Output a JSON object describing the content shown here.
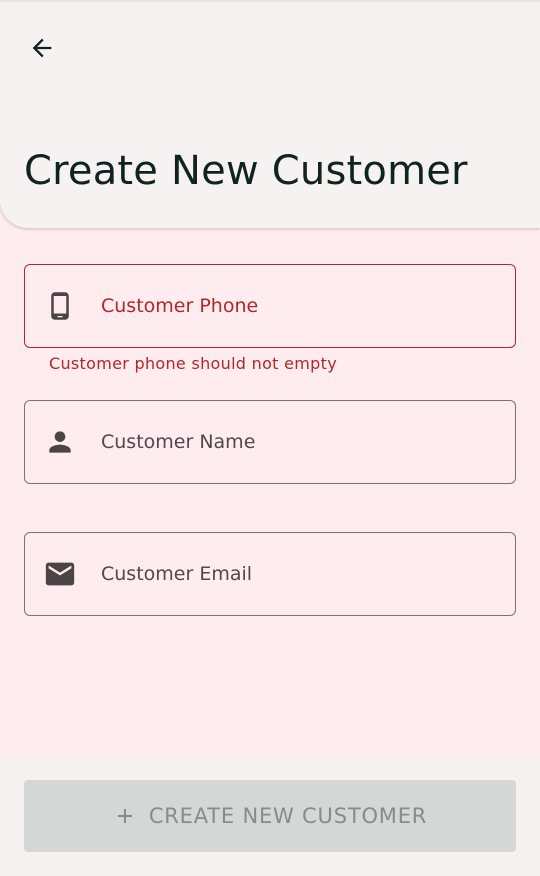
{
  "header": {
    "back_icon": "arrow-left-icon",
    "title": "Create New Customer"
  },
  "form": {
    "phone": {
      "placeholder": "Customer Phone",
      "icon": "smartphone-icon",
      "error": "Customer phone should not empty"
    },
    "name": {
      "placeholder": "Customer Name",
      "icon": "person-icon"
    },
    "email": {
      "placeholder": "Customer Email",
      "icon": "email-icon"
    }
  },
  "footer": {
    "create_button_label": "CREATE NEW CUSTOMER",
    "create_button_icon": "plus-icon",
    "create_button_enabled": false
  },
  "colors": {
    "background": "#ffecef",
    "app_bar": "#f7f2f2",
    "error": "#b3262b",
    "title_text": "#0f2320",
    "disabled_button": "#d5d7d6",
    "disabled_text": "#878b8a"
  }
}
